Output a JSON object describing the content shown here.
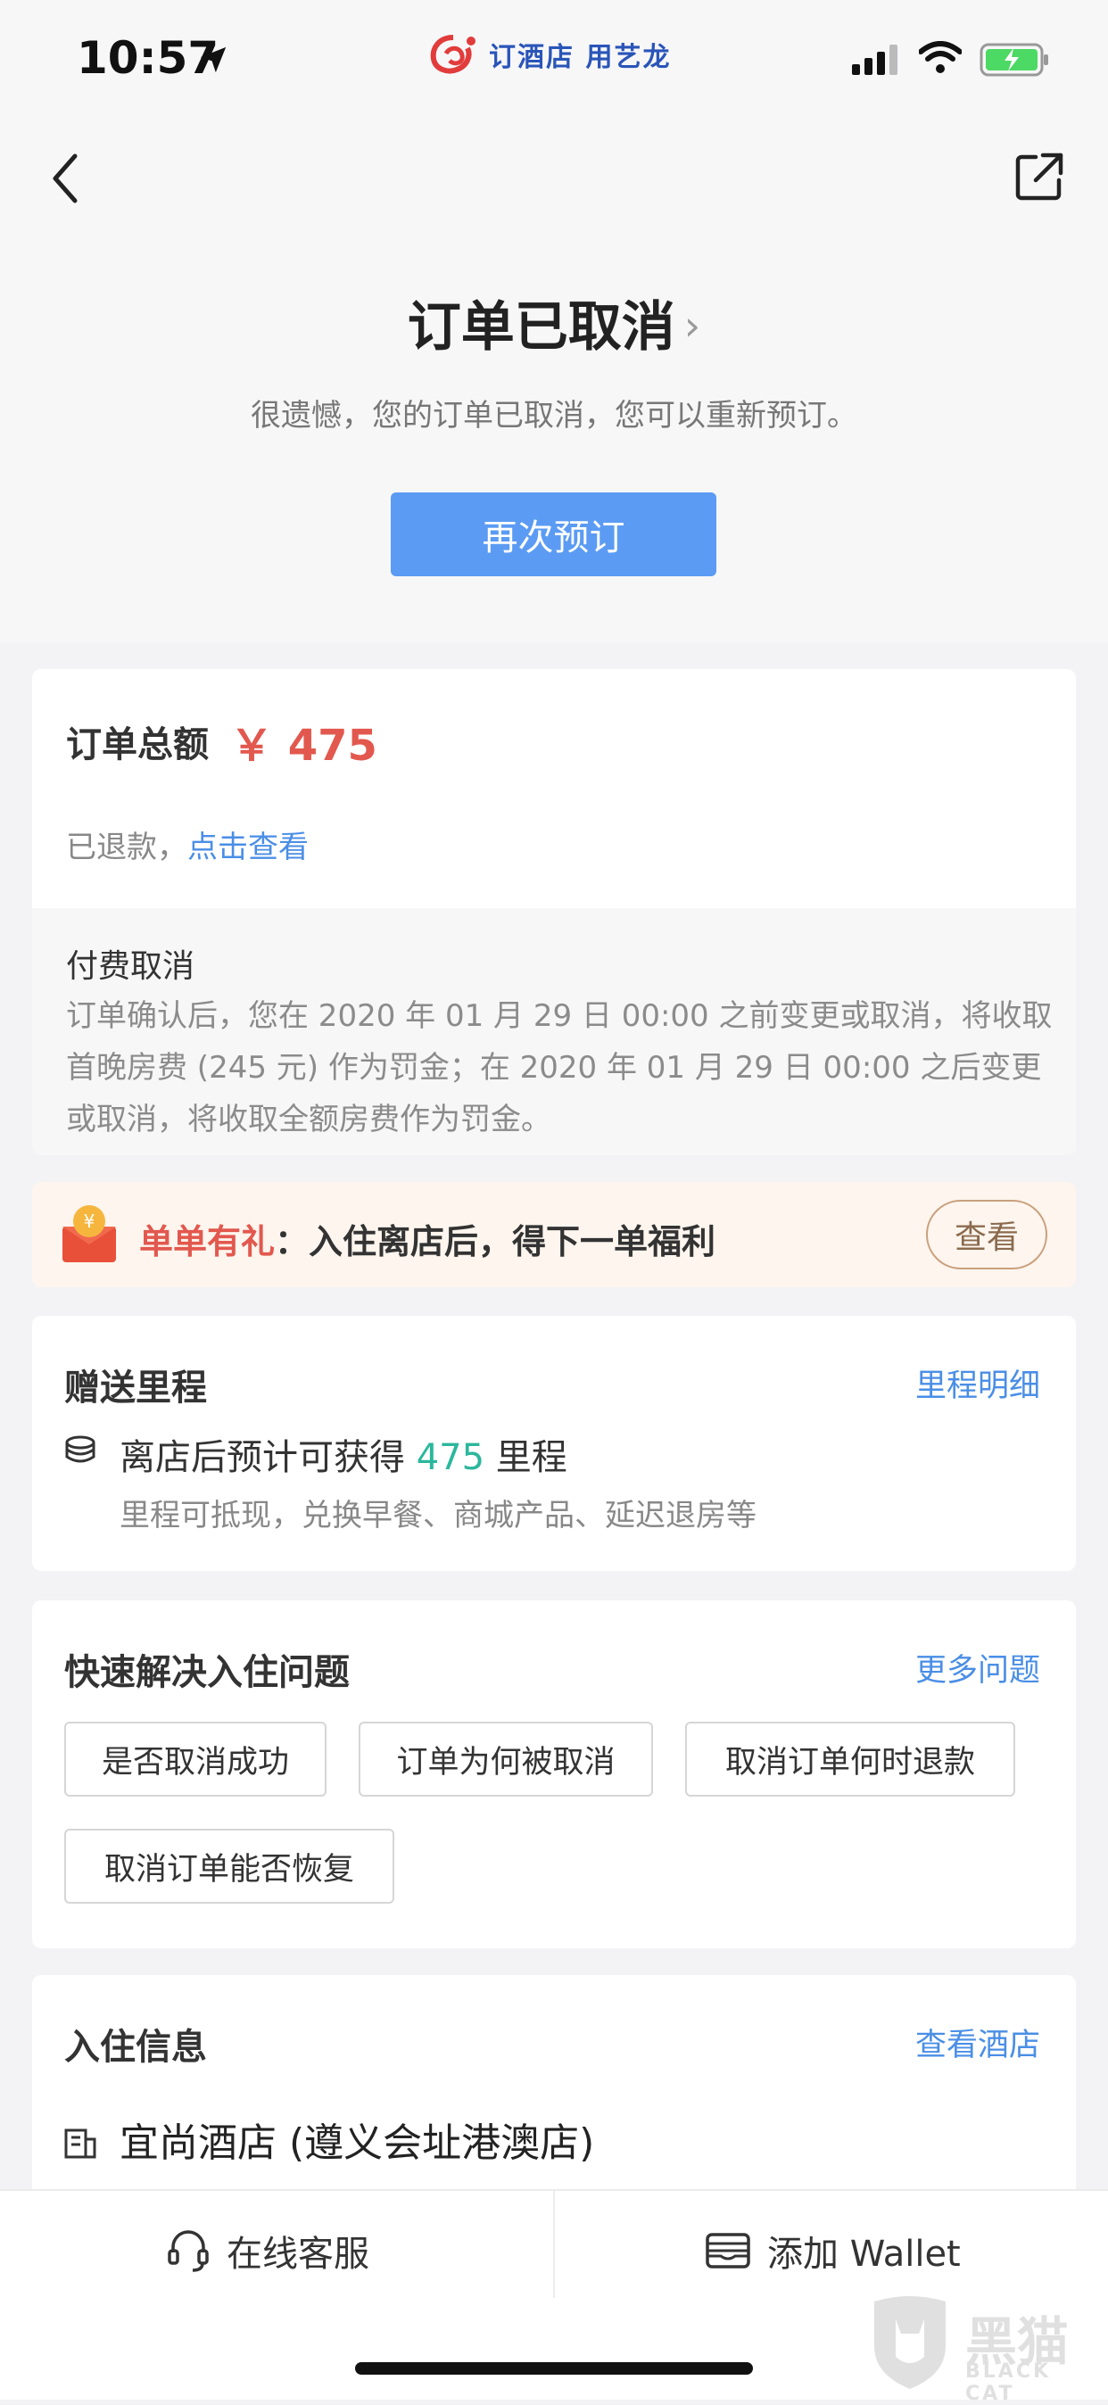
{
  "status_bar": {
    "time": "10:57"
  },
  "brand": {
    "text": "订酒店 用艺龙"
  },
  "order_status": {
    "title": "订单已取消",
    "subtitle": "很遗憾，您的订单已取消，您可以重新预订。",
    "rebook_label": "再次预订"
  },
  "order_summary": {
    "total_label": "订单总额",
    "total_amount": "￥ 475",
    "refund_text": "已退款，",
    "refund_link": "点击查看",
    "policy_title": "付费取消",
    "policy_text": "订单确认后，您在 2020 年 01 月 29 日 00:00 之前变更或取消，将收取首晚房费 (245 元) 作为罚金；在 2020 年 01 月 29 日 00:00 之后变更或取消，将收取全额房费作为罚金。"
  },
  "gift": {
    "label_highlight": "单单有礼",
    "label_rest": "：入住离店后，得下一单福利",
    "button": "查看"
  },
  "mileage": {
    "title": "赠送里程",
    "detail_link": "里程明细",
    "earn_prefix": "离店后预计可获得 ",
    "earn_amount": "475",
    "earn_suffix": " 里程",
    "note": "里程可抵现，兑换早餐、商城产品、延迟退房等"
  },
  "faq": {
    "title": "快速解决入住问题",
    "more_link": "更多问题",
    "chips": [
      "是否取消成功",
      "订单为何被取消",
      "取消订单何时退款",
      "取消订单能否恢复"
    ]
  },
  "checkin": {
    "title": "入住信息",
    "view_hotel_link": "查看酒店",
    "hotel_name": "宜尚酒店 (遵义会址港澳店)"
  },
  "bottom_bar": {
    "service_label": "在线客服",
    "wallet_label": "添加 Wallet"
  },
  "watermark": {
    "cn": "黑猫",
    "en": "BLACK CAT"
  },
  "colors": {
    "primary_button": "#5b9bf3",
    "link": "#4a8ee6",
    "price": "#e2584e",
    "mileage_green": "#2bb79c"
  }
}
